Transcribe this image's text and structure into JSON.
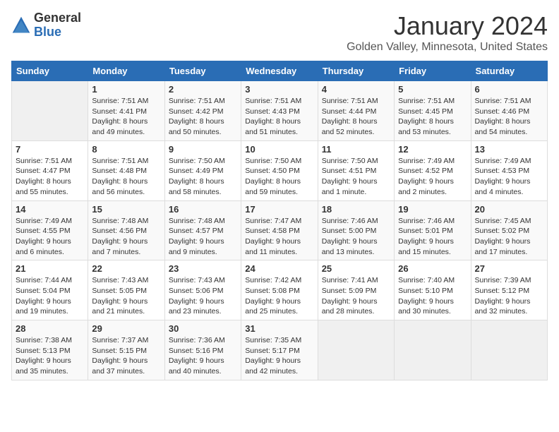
{
  "logo": {
    "general": "General",
    "blue": "Blue"
  },
  "title": "January 2024",
  "location": "Golden Valley, Minnesota, United States",
  "days_of_week": [
    "Sunday",
    "Monday",
    "Tuesday",
    "Wednesday",
    "Thursday",
    "Friday",
    "Saturday"
  ],
  "weeks": [
    [
      {
        "day": "",
        "sunrise": "",
        "sunset": "",
        "daylight": ""
      },
      {
        "day": "1",
        "sunrise": "Sunrise: 7:51 AM",
        "sunset": "Sunset: 4:41 PM",
        "daylight": "Daylight: 8 hours and 49 minutes."
      },
      {
        "day": "2",
        "sunrise": "Sunrise: 7:51 AM",
        "sunset": "Sunset: 4:42 PM",
        "daylight": "Daylight: 8 hours and 50 minutes."
      },
      {
        "day": "3",
        "sunrise": "Sunrise: 7:51 AM",
        "sunset": "Sunset: 4:43 PM",
        "daylight": "Daylight: 8 hours and 51 minutes."
      },
      {
        "day": "4",
        "sunrise": "Sunrise: 7:51 AM",
        "sunset": "Sunset: 4:44 PM",
        "daylight": "Daylight: 8 hours and 52 minutes."
      },
      {
        "day": "5",
        "sunrise": "Sunrise: 7:51 AM",
        "sunset": "Sunset: 4:45 PM",
        "daylight": "Daylight: 8 hours and 53 minutes."
      },
      {
        "day": "6",
        "sunrise": "Sunrise: 7:51 AM",
        "sunset": "Sunset: 4:46 PM",
        "daylight": "Daylight: 8 hours and 54 minutes."
      }
    ],
    [
      {
        "day": "7",
        "sunrise": "Sunrise: 7:51 AM",
        "sunset": "Sunset: 4:47 PM",
        "daylight": "Daylight: 8 hours and 55 minutes."
      },
      {
        "day": "8",
        "sunrise": "Sunrise: 7:51 AM",
        "sunset": "Sunset: 4:48 PM",
        "daylight": "Daylight: 8 hours and 56 minutes."
      },
      {
        "day": "9",
        "sunrise": "Sunrise: 7:50 AM",
        "sunset": "Sunset: 4:49 PM",
        "daylight": "Daylight: 8 hours and 58 minutes."
      },
      {
        "day": "10",
        "sunrise": "Sunrise: 7:50 AM",
        "sunset": "Sunset: 4:50 PM",
        "daylight": "Daylight: 8 hours and 59 minutes."
      },
      {
        "day": "11",
        "sunrise": "Sunrise: 7:50 AM",
        "sunset": "Sunset: 4:51 PM",
        "daylight": "Daylight: 9 hours and 1 minute."
      },
      {
        "day": "12",
        "sunrise": "Sunrise: 7:49 AM",
        "sunset": "Sunset: 4:52 PM",
        "daylight": "Daylight: 9 hours and 2 minutes."
      },
      {
        "day": "13",
        "sunrise": "Sunrise: 7:49 AM",
        "sunset": "Sunset: 4:53 PM",
        "daylight": "Daylight: 9 hours and 4 minutes."
      }
    ],
    [
      {
        "day": "14",
        "sunrise": "Sunrise: 7:49 AM",
        "sunset": "Sunset: 4:55 PM",
        "daylight": "Daylight: 9 hours and 6 minutes."
      },
      {
        "day": "15",
        "sunrise": "Sunrise: 7:48 AM",
        "sunset": "Sunset: 4:56 PM",
        "daylight": "Daylight: 9 hours and 7 minutes."
      },
      {
        "day": "16",
        "sunrise": "Sunrise: 7:48 AM",
        "sunset": "Sunset: 4:57 PM",
        "daylight": "Daylight: 9 hours and 9 minutes."
      },
      {
        "day": "17",
        "sunrise": "Sunrise: 7:47 AM",
        "sunset": "Sunset: 4:58 PM",
        "daylight": "Daylight: 9 hours and 11 minutes."
      },
      {
        "day": "18",
        "sunrise": "Sunrise: 7:46 AM",
        "sunset": "Sunset: 5:00 PM",
        "daylight": "Daylight: 9 hours and 13 minutes."
      },
      {
        "day": "19",
        "sunrise": "Sunrise: 7:46 AM",
        "sunset": "Sunset: 5:01 PM",
        "daylight": "Daylight: 9 hours and 15 minutes."
      },
      {
        "day": "20",
        "sunrise": "Sunrise: 7:45 AM",
        "sunset": "Sunset: 5:02 PM",
        "daylight": "Daylight: 9 hours and 17 minutes."
      }
    ],
    [
      {
        "day": "21",
        "sunrise": "Sunrise: 7:44 AM",
        "sunset": "Sunset: 5:04 PM",
        "daylight": "Daylight: 9 hours and 19 minutes."
      },
      {
        "day": "22",
        "sunrise": "Sunrise: 7:43 AM",
        "sunset": "Sunset: 5:05 PM",
        "daylight": "Daylight: 9 hours and 21 minutes."
      },
      {
        "day": "23",
        "sunrise": "Sunrise: 7:43 AM",
        "sunset": "Sunset: 5:06 PM",
        "daylight": "Daylight: 9 hours and 23 minutes."
      },
      {
        "day": "24",
        "sunrise": "Sunrise: 7:42 AM",
        "sunset": "Sunset: 5:08 PM",
        "daylight": "Daylight: 9 hours and 25 minutes."
      },
      {
        "day": "25",
        "sunrise": "Sunrise: 7:41 AM",
        "sunset": "Sunset: 5:09 PM",
        "daylight": "Daylight: 9 hours and 28 minutes."
      },
      {
        "day": "26",
        "sunrise": "Sunrise: 7:40 AM",
        "sunset": "Sunset: 5:10 PM",
        "daylight": "Daylight: 9 hours and 30 minutes."
      },
      {
        "day": "27",
        "sunrise": "Sunrise: 7:39 AM",
        "sunset": "Sunset: 5:12 PM",
        "daylight": "Daylight: 9 hours and 32 minutes."
      }
    ],
    [
      {
        "day": "28",
        "sunrise": "Sunrise: 7:38 AM",
        "sunset": "Sunset: 5:13 PM",
        "daylight": "Daylight: 9 hours and 35 minutes."
      },
      {
        "day": "29",
        "sunrise": "Sunrise: 7:37 AM",
        "sunset": "Sunset: 5:15 PM",
        "daylight": "Daylight: 9 hours and 37 minutes."
      },
      {
        "day": "30",
        "sunrise": "Sunrise: 7:36 AM",
        "sunset": "Sunset: 5:16 PM",
        "daylight": "Daylight: 9 hours and 40 minutes."
      },
      {
        "day": "31",
        "sunrise": "Sunrise: 7:35 AM",
        "sunset": "Sunset: 5:17 PM",
        "daylight": "Daylight: 9 hours and 42 minutes."
      },
      {
        "day": "",
        "sunrise": "",
        "sunset": "",
        "daylight": ""
      },
      {
        "day": "",
        "sunrise": "",
        "sunset": "",
        "daylight": ""
      },
      {
        "day": "",
        "sunrise": "",
        "sunset": "",
        "daylight": ""
      }
    ]
  ]
}
